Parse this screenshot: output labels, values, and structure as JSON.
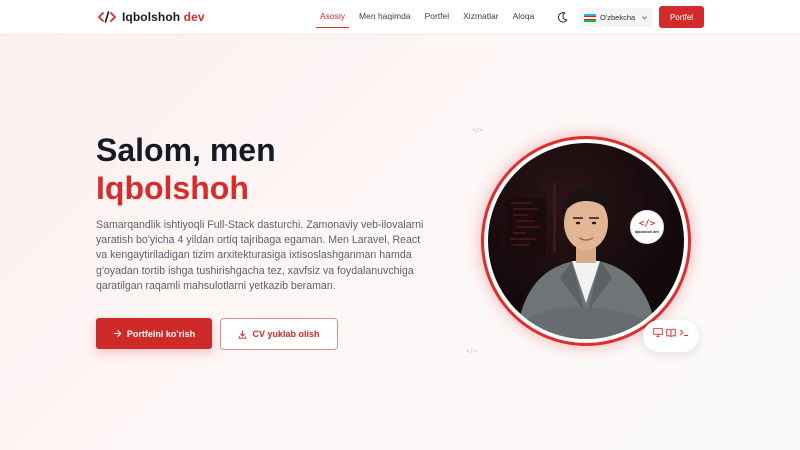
{
  "brand": {
    "name": "Iqbolshoh",
    "suffix": "dev",
    "mark": "</>"
  },
  "nav": {
    "items": [
      {
        "label": "Asosiy",
        "active": true
      },
      {
        "label": "Men haqimda",
        "active": false
      },
      {
        "label": "Portfel",
        "active": false
      },
      {
        "label": "Xizmatlar",
        "active": false
      },
      {
        "label": "Aloqa",
        "active": false
      }
    ],
    "theme_icon": "moon-icon",
    "language": {
      "label": "O'zbekcha",
      "flag": "uz-flag",
      "icon": "chevron-down-icon"
    },
    "cta_label": "Portfel"
  },
  "hero": {
    "greeting": "Salom, men",
    "name": "Iqbolshoh",
    "description": "Samarqandlik ishtiyoqli Full-Stack dasturchi. Zamonaviy veb-ilovalarni yaratish bo'yicha 4 yildan ortiq tajribaga egaman. Men Laravel, React va kengaytiriladigan tizim arxitekturasiga ixtisoslashganman hamda g'oyadan tortib ishga tushirishgacha tez, xavfsiz va foydalanuvchiga qaratilgan raqamli mahsulotlarni yetkazib beraman.",
    "primary_button": {
      "label": "Portfelni ko'rish",
      "icon": "arrow-right-icon"
    },
    "secondary_button": {
      "label": "CV yuklab olish",
      "icon": "download-icon"
    }
  },
  "portrait": {
    "badge_mark": "</>",
    "badge_text": "Iqbolshoh dev",
    "tools": [
      "monitor-icon",
      "book-icon",
      "terminal-icon"
    ]
  },
  "colors": {
    "accent": "#d92b2b",
    "text_dark": "#161a24",
    "text_muted": "#5b6170"
  }
}
